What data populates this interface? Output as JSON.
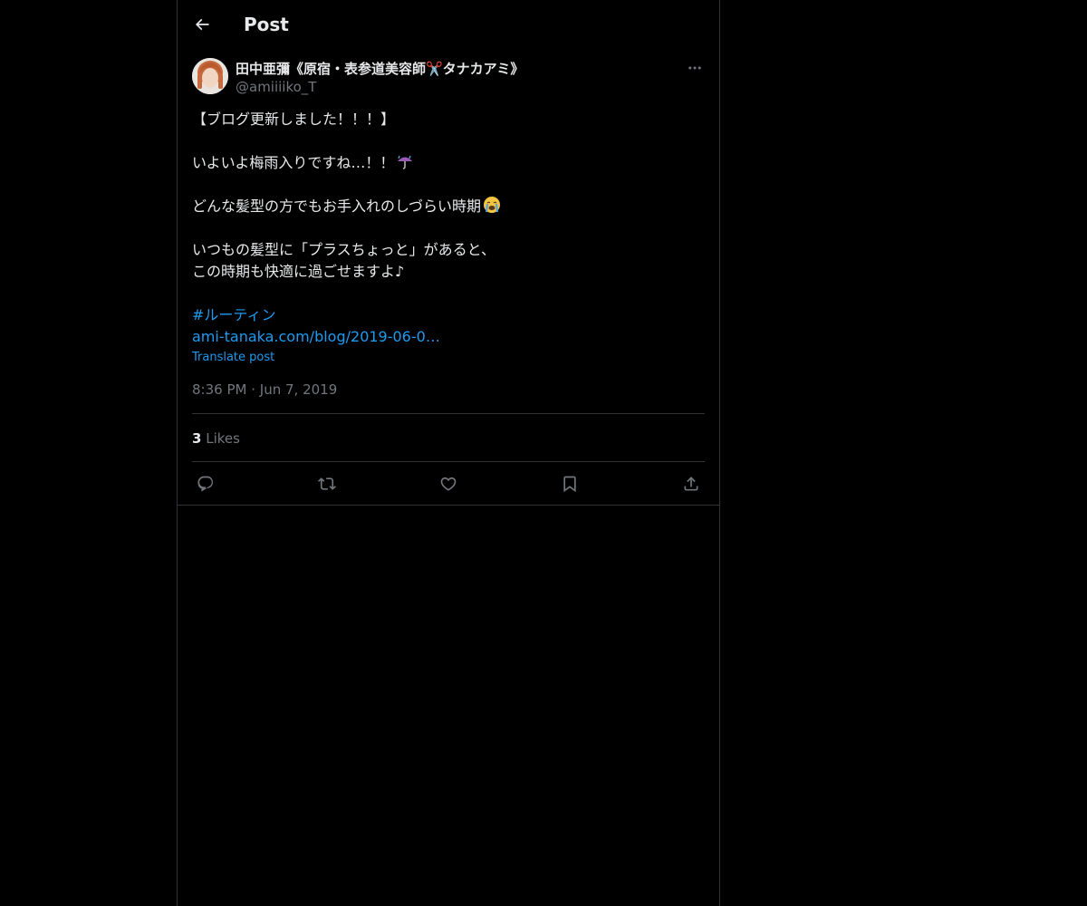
{
  "header": {
    "title": "Post"
  },
  "post": {
    "author_name": "田中亜彌《原宿・表参道美容師✂️タナカアミ》",
    "author_handle": "@amiiiiko_T",
    "lines": {
      "l1": "【ブログ更新しました！！！】",
      "l2": "いよいよ梅雨入りですね…！！",
      "l2_emoji": "umbrella-with-rain-emoji",
      "l3": "どんな髪型の方でもお手入れのしづらい時期",
      "l3_emoji": "loudly-crying-face-emoji",
      "l4": "いつもの髪型に「プラスちょっと」があると、",
      "l5": "この時期も快適に過ごせますよ♪"
    },
    "hashtag": "#ルーティン",
    "url": "ami-tanaka.com/blog/2019-06-0…",
    "translate_label": "Translate post",
    "time": "8:36 PM",
    "separator": "·",
    "date": "Jun 7, 2019",
    "likes_count": "3",
    "likes_label": "Likes"
  },
  "actions": [
    {
      "icon": "reply-icon"
    },
    {
      "icon": "repost-icon"
    },
    {
      "icon": "like-icon"
    },
    {
      "icon": "bookmark-icon"
    },
    {
      "icon": "share-icon"
    }
  ],
  "colors": {
    "background": "#000000",
    "text": "#e7e9ea",
    "secondary": "#71767b",
    "link": "#1d9bf0",
    "border": "#2f3336"
  }
}
